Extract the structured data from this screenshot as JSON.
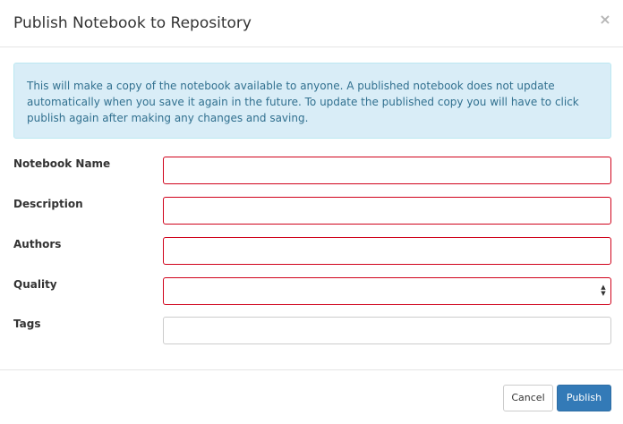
{
  "modal": {
    "title": "Publish Notebook to Repository",
    "close_label": "×"
  },
  "alert": {
    "text": "This will make a copy of the notebook available to anyone. A published notebook does not update automatically when you save it again in the future. To update the published copy you will have to click publish again after making any changes and saving."
  },
  "form": {
    "notebook_name": {
      "label": "Notebook Name",
      "value": "",
      "invalid": true
    },
    "description": {
      "label": "Description",
      "value": "",
      "invalid": true
    },
    "authors": {
      "label": "Authors",
      "value": "",
      "invalid": true
    },
    "quality": {
      "label": "Quality",
      "selected": "",
      "invalid": true
    },
    "tags": {
      "label": "Tags",
      "value": "",
      "invalid": false
    }
  },
  "footer": {
    "cancel_label": "Cancel",
    "publish_label": "Publish"
  },
  "colors": {
    "invalid_border": "#d0021b",
    "alert_bg": "#d9edf7",
    "alert_text": "#31708f",
    "primary": "#337ab7"
  }
}
